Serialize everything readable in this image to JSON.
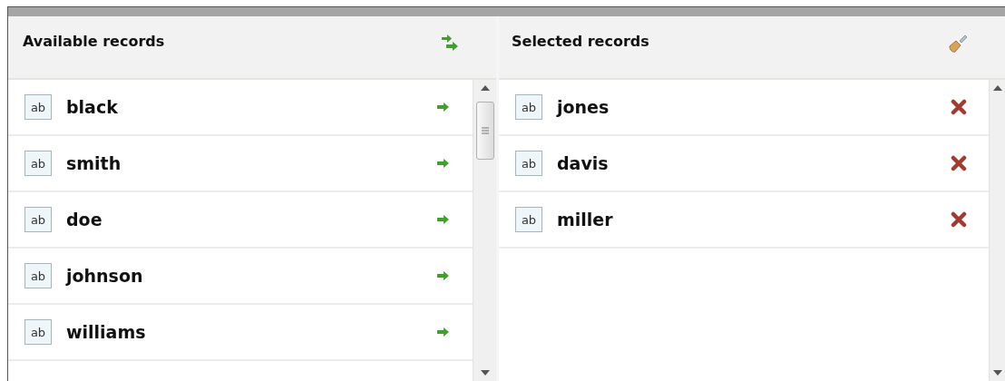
{
  "available": {
    "title": "Available records",
    "items": [
      {
        "icon_text": "ab",
        "name": "black"
      },
      {
        "icon_text": "ab",
        "name": "smith"
      },
      {
        "icon_text": "ab",
        "name": "doe"
      },
      {
        "icon_text": "ab",
        "name": "johnson"
      },
      {
        "icon_text": "ab",
        "name": "williams"
      }
    ]
  },
  "selected": {
    "title": "Selected records",
    "items": [
      {
        "icon_text": "ab",
        "name": "jones"
      },
      {
        "icon_text": "ab",
        "name": "davis"
      },
      {
        "icon_text": "ab",
        "name": "miller"
      }
    ]
  }
}
